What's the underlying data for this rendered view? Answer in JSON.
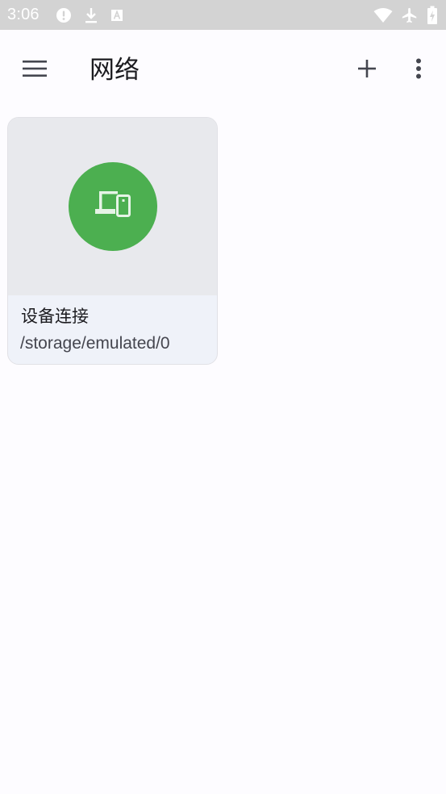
{
  "status_bar": {
    "time": "3:06",
    "left_icons": [
      "alert-circle-icon",
      "download-icon",
      "a-box-icon"
    ],
    "right_icons": [
      "wifi-icon",
      "airplane-icon",
      "battery-charging-icon"
    ]
  },
  "app_bar": {
    "title": "网络",
    "menu_icon": "menu-icon",
    "add_icon": "add-icon",
    "more_icon": "more-vert-icon"
  },
  "cards": [
    {
      "title": "设备连接",
      "subtitle": "/storage/emulated/0",
      "icon": "devices-icon",
      "icon_bg": "#4caf50"
    }
  ],
  "colors": {
    "background": "#fdfcff",
    "status_bar": "#d3d3d3",
    "card_media": "#e8e9ed",
    "card_footer": "#eff2f9",
    "accent_green": "#4caf50"
  }
}
